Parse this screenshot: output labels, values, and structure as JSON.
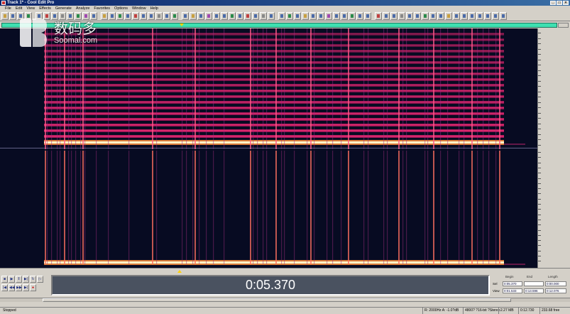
{
  "window": {
    "title": "Track 1* - Cool Edit Pro"
  },
  "menu": {
    "items": [
      "File",
      "Edit",
      "View",
      "Effects",
      "Generate",
      "Analyze",
      "Favorites",
      "Options",
      "Window",
      "Help"
    ]
  },
  "watermark": {
    "cn": "数码多",
    "en": "Soomal.com"
  },
  "colors": {
    "spectral_bg": "#070b22",
    "harmonic": "#e0206a",
    "fundamental": "#fff4c8",
    "overview": "#3ee0b0",
    "time_display_bg": "#4a5260"
  },
  "time_display": {
    "value": "0:05.370"
  },
  "selection_view": {
    "headers": [
      "Begin",
      "End",
      "Length"
    ],
    "rows": [
      {
        "label": "Sel",
        "values": [
          "0:05.370",
          "",
          "0:00.000"
        ]
      },
      {
        "label": "View",
        "values": [
          "0:01.533",
          "0:13.596",
          "0:12.076"
        ]
      }
    ]
  },
  "status": {
    "left": "Stopped",
    "cells": [
      "R: 2000Hz  A: -1.0?dB",
      "4800?  ?16-bit ?Stereo",
      "2.27 MB",
      "0:12.730",
      "233.68 free"
    ]
  },
  "transport": {
    "row1": [
      "stop-button",
      "play-button",
      "pause-button",
      "play-to-end-button",
      "loop-button",
      "play-from-cursor-button"
    ],
    "row2": [
      "go-start-button",
      "rewind-button",
      "fast-forward-button",
      "go-end-button",
      "record-button"
    ]
  }
}
